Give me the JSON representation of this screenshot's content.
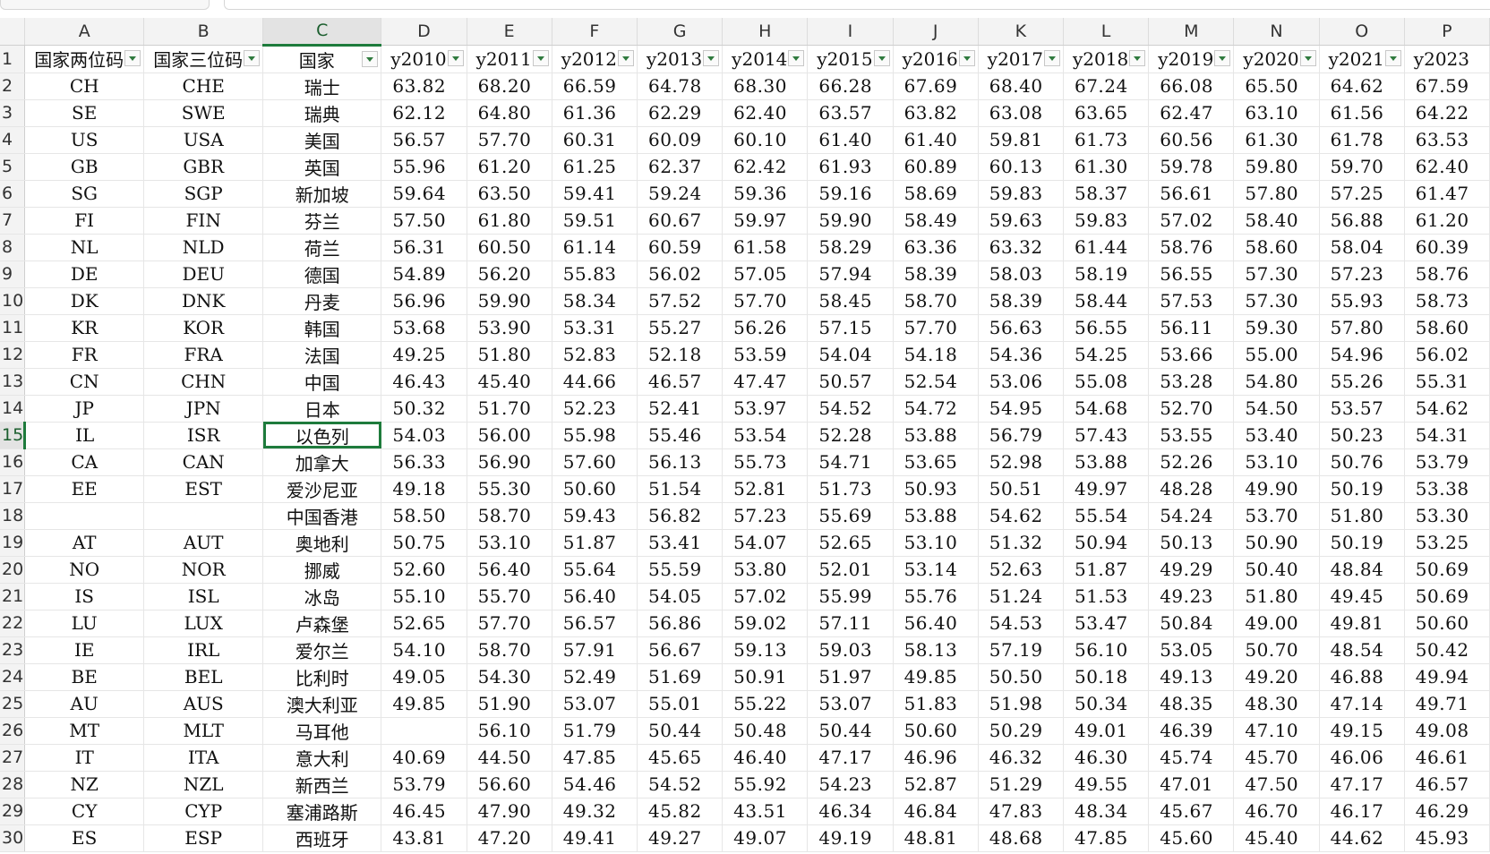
{
  "columns": [
    "A",
    "B",
    "C",
    "D",
    "E",
    "F",
    "G",
    "H",
    "I",
    "J",
    "K",
    "L",
    "M",
    "N",
    "O",
    "P"
  ],
  "header_row": {
    "row_number": "1",
    "cells": [
      "国家两位码",
      "国家三位码",
      "国家",
      "y2010",
      "y2011",
      "y2012",
      "y2013",
      "y2014",
      "y2015",
      "y2016",
      "y2017",
      "y2018",
      "y2019",
      "y2020",
      "y2021",
      "y2023"
    ]
  },
  "rows": [
    {
      "n": "2",
      "cells": [
        "CH",
        "CHE",
        "瑞士",
        "63.82",
        "68.20",
        "66.59",
        "64.78",
        "68.30",
        "66.28",
        "67.69",
        "68.40",
        "67.24",
        "66.08",
        "65.50",
        "64.62",
        "67.59"
      ]
    },
    {
      "n": "3",
      "cells": [
        "SE",
        "SWE",
        "瑞典",
        "62.12",
        "64.80",
        "61.36",
        "62.29",
        "62.40",
        "63.57",
        "63.82",
        "63.08",
        "63.65",
        "62.47",
        "63.10",
        "61.56",
        "64.22"
      ]
    },
    {
      "n": "4",
      "cells": [
        "US",
        "USA",
        "美国",
        "56.57",
        "57.70",
        "60.31",
        "60.09",
        "60.10",
        "61.40",
        "61.40",
        "59.81",
        "61.73",
        "60.56",
        "61.30",
        "61.78",
        "63.53"
      ]
    },
    {
      "n": "5",
      "cells": [
        "GB",
        "GBR",
        "英国",
        "55.96",
        "61.20",
        "61.25",
        "62.37",
        "62.42",
        "61.93",
        "60.89",
        "60.13",
        "61.30",
        "59.78",
        "59.80",
        "59.70",
        "62.40"
      ]
    },
    {
      "n": "6",
      "cells": [
        "SG",
        "SGP",
        "新加坡",
        "59.64",
        "63.50",
        "59.41",
        "59.24",
        "59.36",
        "59.16",
        "58.69",
        "59.83",
        "58.37",
        "56.61",
        "57.80",
        "57.25",
        "61.47"
      ]
    },
    {
      "n": "7",
      "cells": [
        "FI",
        "FIN",
        "芬兰",
        "57.50",
        "61.80",
        "59.51",
        "60.67",
        "59.97",
        "59.90",
        "58.49",
        "59.63",
        "59.83",
        "57.02",
        "58.40",
        "56.88",
        "61.20"
      ]
    },
    {
      "n": "8",
      "cells": [
        "NL",
        "NLD",
        "荷兰",
        "56.31",
        "60.50",
        "61.14",
        "60.59",
        "61.58",
        "58.29",
        "63.36",
        "63.32",
        "61.44",
        "58.76",
        "58.60",
        "58.04",
        "60.39"
      ]
    },
    {
      "n": "9",
      "cells": [
        "DE",
        "DEU",
        "德国",
        "54.89",
        "56.20",
        "55.83",
        "56.02",
        "57.05",
        "57.94",
        "58.39",
        "58.03",
        "58.19",
        "56.55",
        "57.30",
        "57.23",
        "58.76"
      ]
    },
    {
      "n": "10",
      "cells": [
        "DK",
        "DNK",
        "丹麦",
        "56.96",
        "59.90",
        "58.34",
        "57.52",
        "57.70",
        "58.45",
        "58.70",
        "58.39",
        "58.44",
        "57.53",
        "57.30",
        "55.93",
        "58.73"
      ]
    },
    {
      "n": "11",
      "cells": [
        "KR",
        "KOR",
        "韩国",
        "53.68",
        "53.90",
        "53.31",
        "55.27",
        "56.26",
        "57.15",
        "57.70",
        "56.63",
        "56.55",
        "56.11",
        "59.30",
        "57.80",
        "58.60"
      ]
    },
    {
      "n": "12",
      "cells": [
        "FR",
        "FRA",
        "法国",
        "49.25",
        "51.80",
        "52.83",
        "52.18",
        "53.59",
        "54.04",
        "54.18",
        "54.36",
        "54.25",
        "53.66",
        "55.00",
        "54.96",
        "56.02"
      ]
    },
    {
      "n": "13",
      "cells": [
        "CN",
        "CHN",
        "中国",
        "46.43",
        "45.40",
        "44.66",
        "46.57",
        "47.47",
        "50.57",
        "52.54",
        "53.06",
        "55.08",
        "53.28",
        "54.80",
        "55.26",
        "55.31"
      ]
    },
    {
      "n": "14",
      "cells": [
        "JP",
        "JPN",
        "日本",
        "50.32",
        "51.70",
        "52.23",
        "52.41",
        "53.97",
        "54.52",
        "54.72",
        "54.95",
        "54.68",
        "52.70",
        "54.50",
        "53.57",
        "54.62"
      ]
    },
    {
      "n": "15",
      "cells": [
        "IL",
        "ISR",
        "以色列",
        "54.03",
        "56.00",
        "55.98",
        "55.46",
        "53.54",
        "52.28",
        "53.88",
        "56.79",
        "57.43",
        "53.55",
        "53.40",
        "50.23",
        "54.31"
      ]
    },
    {
      "n": "16",
      "cells": [
        "CA",
        "CAN",
        "加拿大",
        "56.33",
        "56.90",
        "57.60",
        "56.13",
        "55.73",
        "54.71",
        "53.65",
        "52.98",
        "53.88",
        "52.26",
        "53.10",
        "50.76",
        "53.79"
      ]
    },
    {
      "n": "17",
      "cells": [
        "EE",
        "EST",
        "爱沙尼亚",
        "49.18",
        "55.30",
        "50.60",
        "51.54",
        "52.81",
        "51.73",
        "50.93",
        "50.51",
        "49.97",
        "48.28",
        "49.90",
        "50.19",
        "53.38"
      ]
    },
    {
      "n": "18",
      "cells": [
        "",
        "",
        "中国香港",
        "58.50",
        "58.70",
        "59.43",
        "56.82",
        "57.23",
        "55.69",
        "53.88",
        "54.62",
        "55.54",
        "54.24",
        "53.70",
        "51.80",
        "53.30"
      ]
    },
    {
      "n": "19",
      "cells": [
        "AT",
        "AUT",
        "奥地利",
        "50.75",
        "53.10",
        "51.87",
        "53.41",
        "54.07",
        "52.65",
        "53.10",
        "51.32",
        "50.94",
        "50.13",
        "50.90",
        "50.19",
        "53.25"
      ]
    },
    {
      "n": "20",
      "cells": [
        "NO",
        "NOR",
        "挪威",
        "52.60",
        "56.40",
        "55.64",
        "55.59",
        "53.80",
        "52.01",
        "53.14",
        "52.63",
        "51.87",
        "49.29",
        "50.40",
        "48.84",
        "50.69"
      ]
    },
    {
      "n": "21",
      "cells": [
        "IS",
        "ISL",
        "冰岛",
        "55.10",
        "55.70",
        "56.40",
        "54.05",
        "57.02",
        "55.99",
        "55.76",
        "51.24",
        "51.53",
        "49.23",
        "51.80",
        "49.45",
        "50.69"
      ]
    },
    {
      "n": "22",
      "cells": [
        "LU",
        "LUX",
        "卢森堡",
        "52.65",
        "57.70",
        "56.57",
        "56.86",
        "59.02",
        "57.11",
        "56.40",
        "54.53",
        "53.47",
        "50.84",
        "49.00",
        "49.81",
        "50.60"
      ]
    },
    {
      "n": "23",
      "cells": [
        "IE",
        "IRL",
        "爱尔兰",
        "54.10",
        "58.70",
        "57.91",
        "56.67",
        "59.13",
        "59.03",
        "58.13",
        "57.19",
        "56.10",
        "53.05",
        "50.70",
        "48.54",
        "50.42"
      ]
    },
    {
      "n": "24",
      "cells": [
        "BE",
        "BEL",
        "比利时",
        "49.05",
        "54.30",
        "52.49",
        "51.69",
        "50.91",
        "51.97",
        "49.85",
        "50.50",
        "50.18",
        "49.13",
        "49.20",
        "46.88",
        "49.94"
      ]
    },
    {
      "n": "25",
      "cells": [
        "AU",
        "AUS",
        "澳大利亚",
        "49.85",
        "51.90",
        "53.07",
        "55.01",
        "55.22",
        "53.07",
        "51.83",
        "51.98",
        "50.34",
        "48.35",
        "48.30",
        "47.14",
        "49.71"
      ]
    },
    {
      "n": "26",
      "cells": [
        "MT",
        "MLT",
        "马耳他",
        "",
        "56.10",
        "51.79",
        "50.44",
        "50.48",
        "50.44",
        "50.60",
        "50.29",
        "49.01",
        "46.39",
        "47.10",
        "49.15",
        "49.08"
      ]
    },
    {
      "n": "27",
      "cells": [
        "IT",
        "ITA",
        "意大利",
        "40.69",
        "44.50",
        "47.85",
        "45.65",
        "46.40",
        "47.17",
        "46.96",
        "46.32",
        "46.30",
        "45.74",
        "45.70",
        "46.06",
        "46.61"
      ]
    },
    {
      "n": "28",
      "cells": [
        "NZ",
        "NZL",
        "新西兰",
        "53.79",
        "56.60",
        "54.46",
        "54.52",
        "55.92",
        "54.23",
        "52.87",
        "51.29",
        "49.55",
        "47.01",
        "47.50",
        "47.17",
        "46.57"
      ]
    },
    {
      "n": "29",
      "cells": [
        "CY",
        "CYP",
        "塞浦路斯",
        "46.45",
        "47.90",
        "49.32",
        "45.82",
        "43.51",
        "46.34",
        "46.84",
        "47.83",
        "48.34",
        "45.67",
        "46.70",
        "46.17",
        "46.29"
      ]
    },
    {
      "n": "30",
      "cells": [
        "ES",
        "ESP",
        "西班牙",
        "43.81",
        "47.20",
        "49.41",
        "49.27",
        "49.07",
        "49.19",
        "48.81",
        "48.68",
        "47.85",
        "45.60",
        "45.40",
        "44.62",
        "45.93"
      ]
    }
  ],
  "selection": {
    "column": "C",
    "row": "15"
  },
  "colors": {
    "accent": "#1e7b3c",
    "header_bg": "#f3f3f3",
    "gridline": "#e6e6e6"
  }
}
